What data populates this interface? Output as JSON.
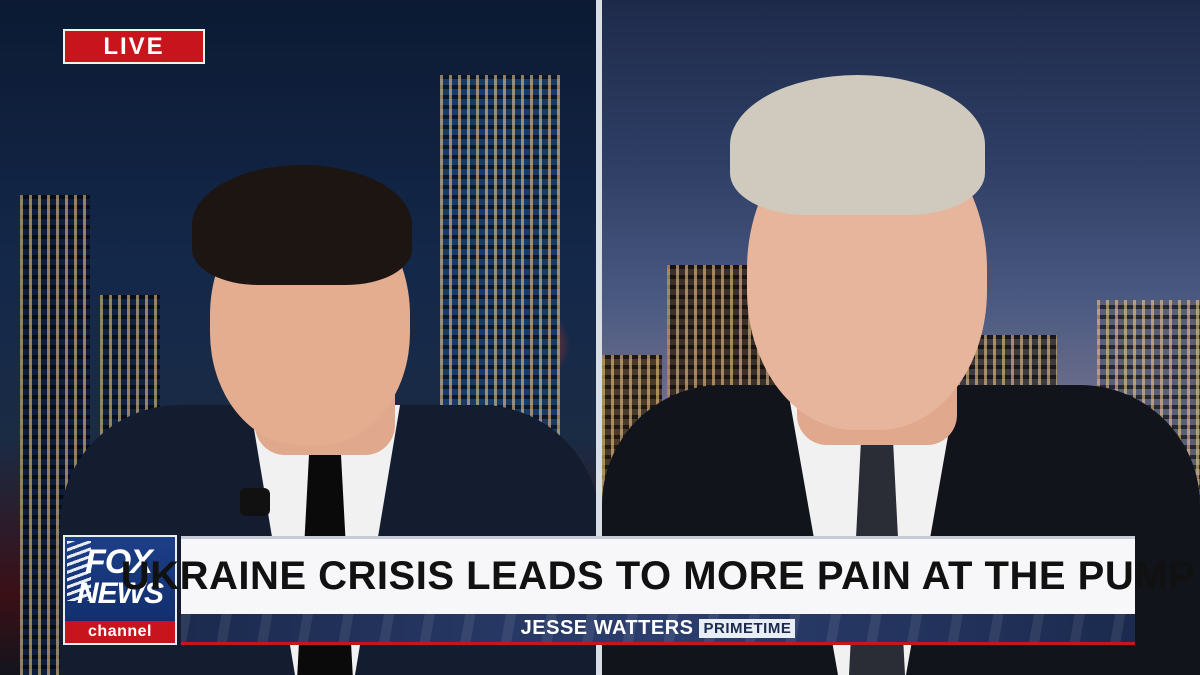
{
  "live_badge": {
    "label": "LIVE"
  },
  "network_logo": {
    "line1": "FOX",
    "line2": "NEWS",
    "line3": "channel"
  },
  "chyron": {
    "headline": "UKRAINE CRISIS LEADS TO MORE PAIN AT THE PUMP",
    "show_name": "JESSE WATTERS",
    "show_subtitle": "PRIMETIME"
  },
  "colors": {
    "brand_red": "#c8141c",
    "brand_blue": "#1d3f88",
    "headline_bg": "#f7f7f9"
  }
}
